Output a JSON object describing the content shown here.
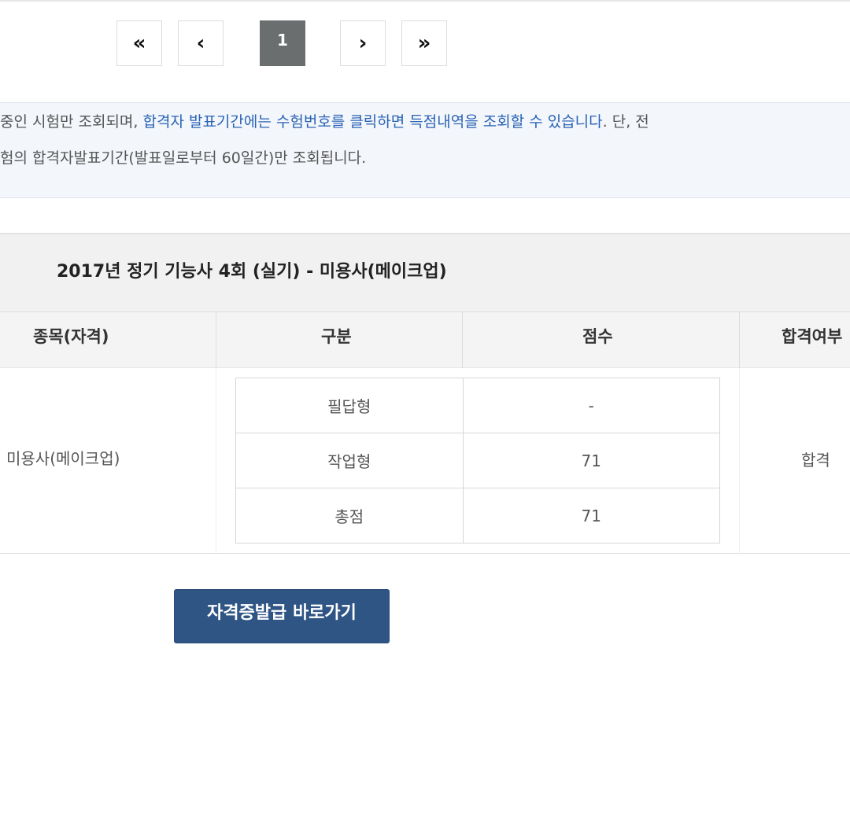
{
  "pagination": {
    "first": "«",
    "prev": "‹",
    "current": "1",
    "next": "›",
    "last": "»"
  },
  "notice": {
    "line1_a": "중인 시험만 조회되며, ",
    "line1_b": "합격자 발표기간에는 수험번호를 클릭하면 득점내역을 조회할 수 있습니다",
    "line1_c": ". 단, 전",
    "line2": "험의 합격자발표기간(발표일로부터 60일간)만 조회됩니다."
  },
  "exam": {
    "title": "2017년 정기 기능사 4회 (실기) - 미용사(메이크업)"
  },
  "table": {
    "headers": {
      "subject": "종목(자격)",
      "category": "구분",
      "score": "점수",
      "result": "합격여부"
    },
    "subject": "미용사(메이크업)",
    "result": "합격",
    "rows": [
      {
        "label": "필답형",
        "score": "-"
      },
      {
        "label": "작업형",
        "score": "71"
      },
      {
        "label": "총점",
        "score": "71"
      }
    ]
  },
  "button": {
    "label": "자격증발급 바로가기"
  },
  "colors": {
    "accent_link": "#2a63b5",
    "button_bg": "#2f5585",
    "active_page_bg": "#6b6e6f"
  }
}
